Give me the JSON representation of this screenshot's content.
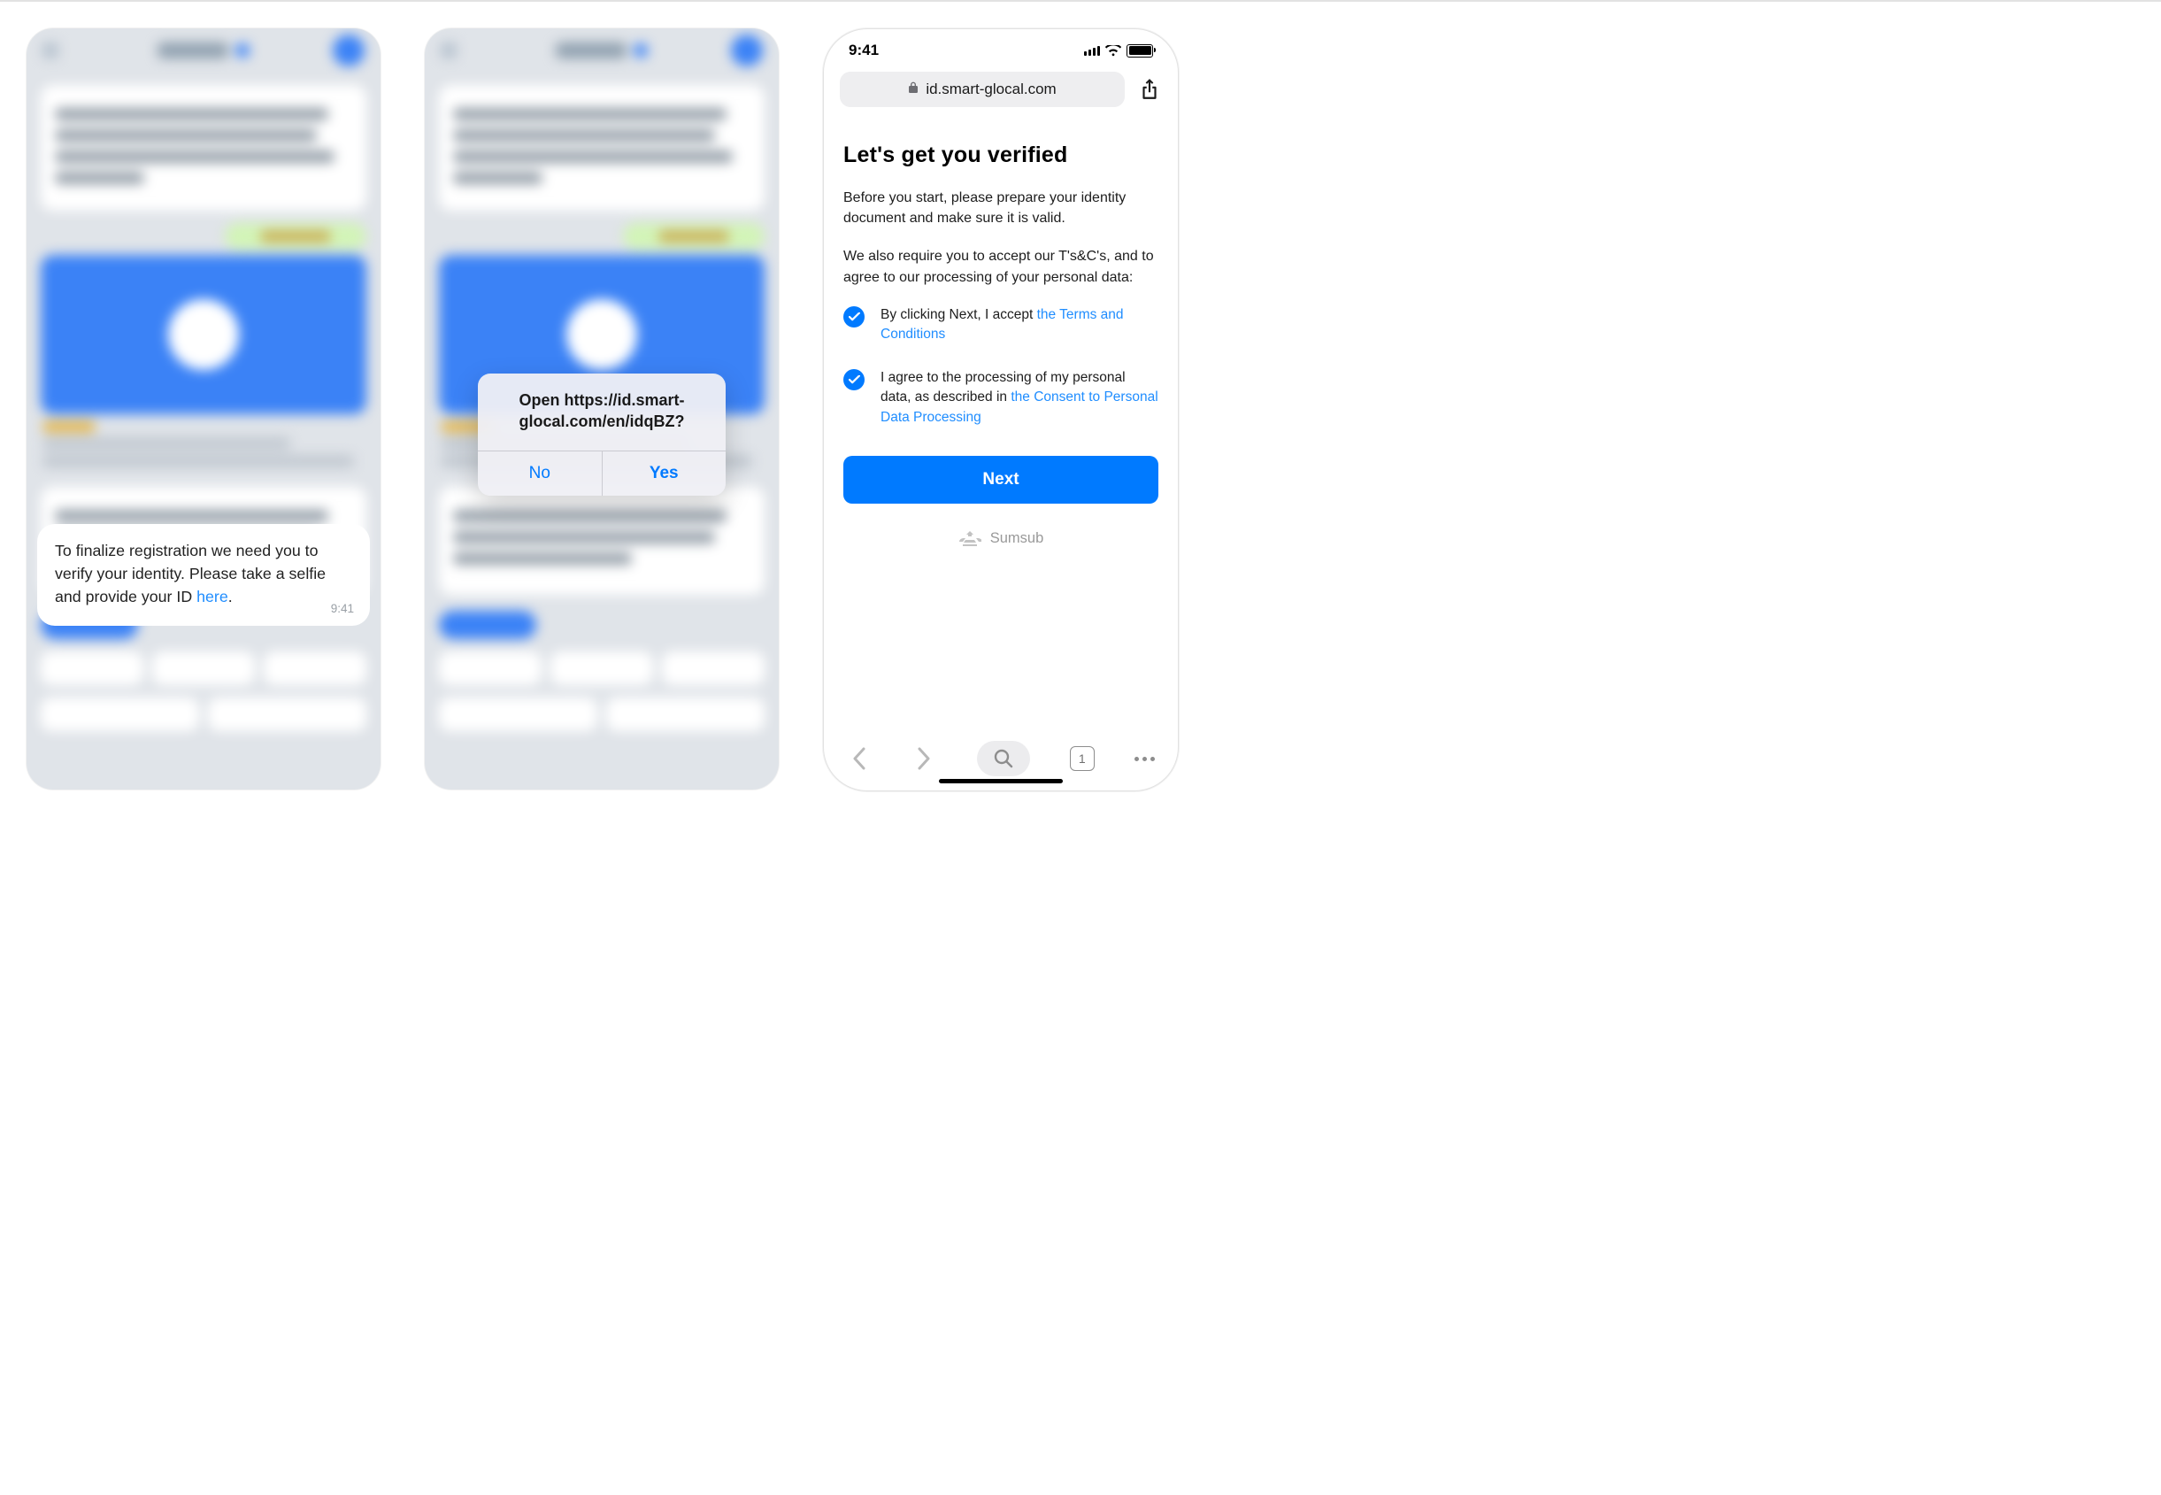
{
  "time": "9:41",
  "phone1": {
    "bubble_text_a": "To finalize registration we need you to verify your identity. Please take a selfie and provide your ID ",
    "bubble_link": "here",
    "bubble_text_b": ".",
    "bubble_time": "9:41"
  },
  "phone2": {
    "alert_msg_a": "Open https://id.smart-",
    "alert_msg_b": "glocal.com/en/idqBZ?",
    "no": "No",
    "yes": "Yes"
  },
  "phone3": {
    "url": "id.smart-glocal.com",
    "title": "Let's get you verified",
    "para1": "Before you start, please prepare your identity document and make sure it is valid.",
    "para2": "We also require you to accept our T's&C's, and to agree to our processing of your personal data:",
    "chk1_a": "By clicking Next, I accept ",
    "chk1_link": "the Terms and Conditions",
    "chk2_a": "I agree to the processing of my personal data, as described in ",
    "chk2_link": "the Consent to Personal Data Processing",
    "next": "Next",
    "brand": "Sumsub",
    "tab_count": "1"
  }
}
